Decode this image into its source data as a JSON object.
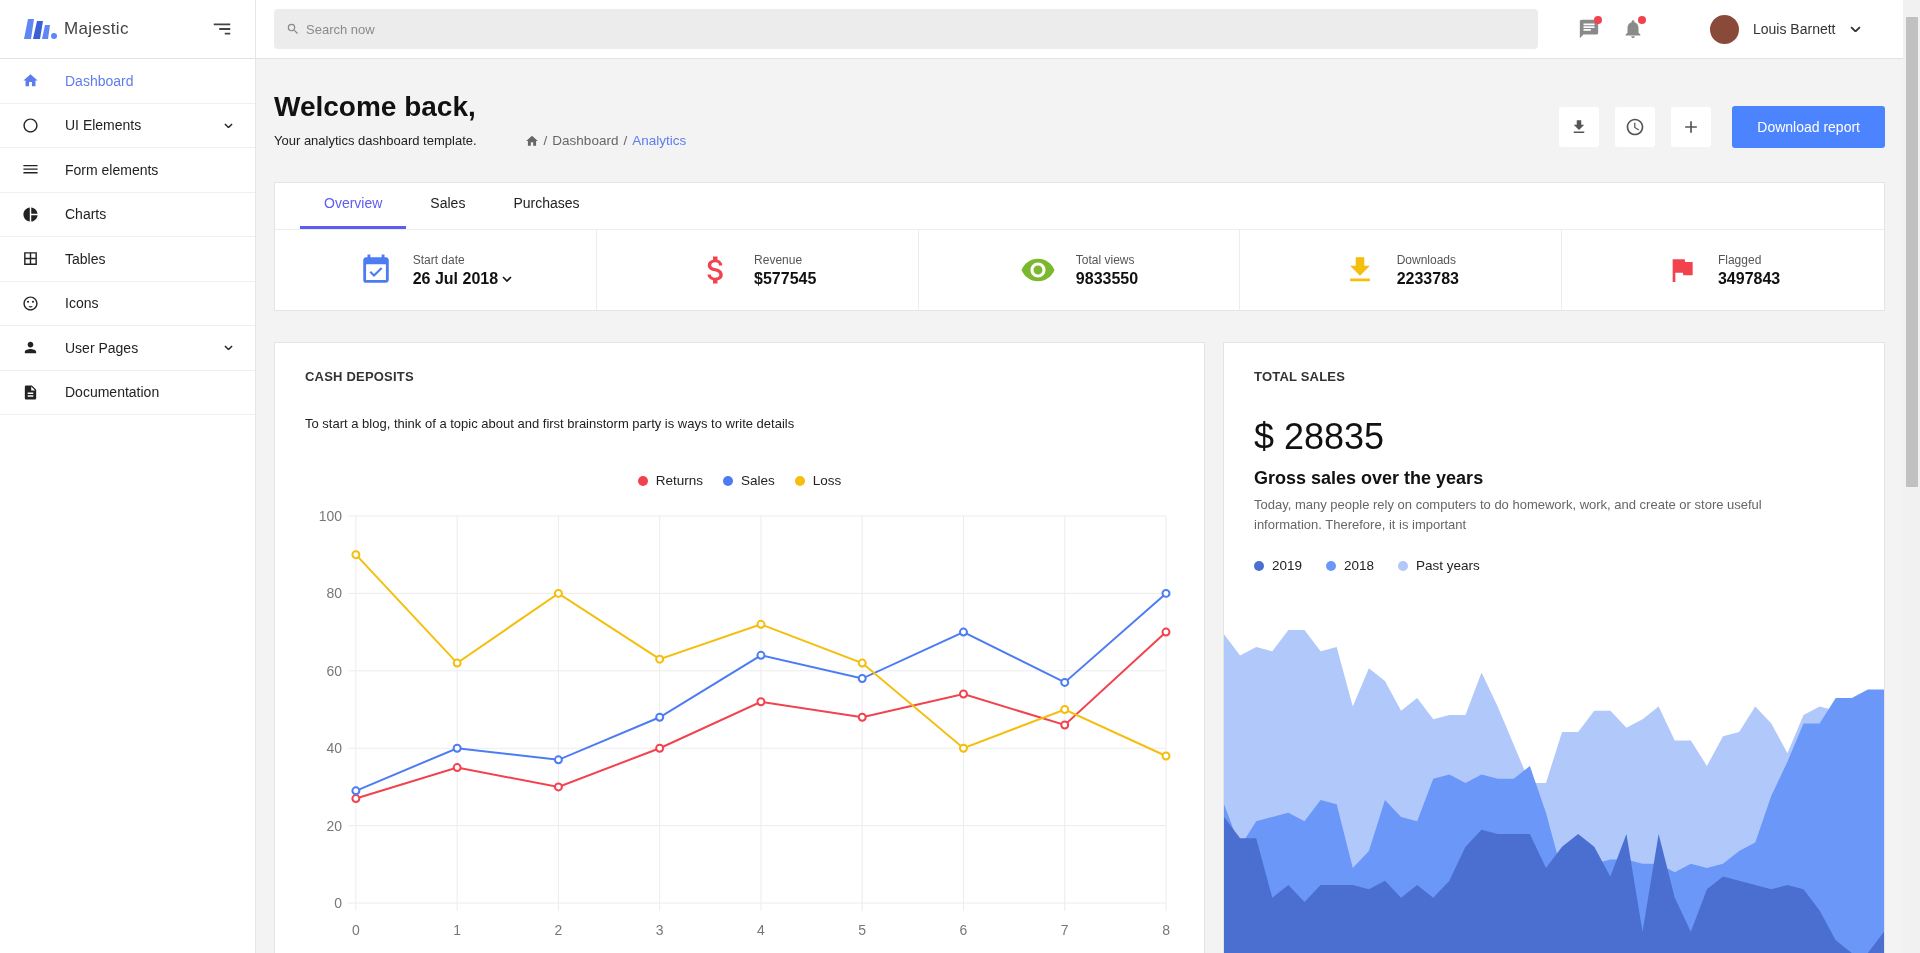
{
  "brand": {
    "name": "Majestic"
  },
  "sidebar": {
    "items": [
      {
        "kind": "home",
        "label": "Dashboard",
        "selected": true,
        "expandable": false
      },
      {
        "kind": "circle",
        "label": "UI Elements",
        "selected": false,
        "expandable": true
      },
      {
        "kind": "lines",
        "label": "Form elements",
        "selected": false,
        "expandable": false
      },
      {
        "kind": "pie",
        "label": "Charts",
        "selected": false,
        "expandable": false
      },
      {
        "kind": "table",
        "label": "Tables",
        "selected": false,
        "expandable": false
      },
      {
        "kind": "smile",
        "label": "Icons",
        "selected": false,
        "expandable": false
      },
      {
        "kind": "person",
        "label": "User Pages",
        "selected": false,
        "expandable": true
      },
      {
        "kind": "doc",
        "label": "Documentation",
        "selected": false,
        "expandable": false
      }
    ]
  },
  "topbar": {
    "search": {
      "placeholder": "Search now"
    },
    "notifications": [
      {
        "kind": "chat",
        "unread": true
      },
      {
        "kind": "bell",
        "unread": true
      }
    ],
    "user": {
      "name": "Louis Barnett"
    }
  },
  "header": {
    "title": "Welcome back,",
    "subtitle": "Your analytics dashboard template.",
    "breadcrumb": {
      "separator": "/",
      "items": [
        {
          "label": "Dashboard",
          "selected": false
        },
        {
          "label": "Analytics",
          "selected": true
        }
      ]
    },
    "actions": [
      {
        "kind": "download"
      },
      {
        "kind": "clock"
      },
      {
        "kind": "plus"
      }
    ],
    "primary_button": "Download report"
  },
  "tabs": [
    {
      "label": "Overview",
      "selected": true
    },
    {
      "label": "Sales",
      "selected": false
    },
    {
      "label": "Purchases",
      "selected": false
    }
  ],
  "stats": [
    {
      "kind": "calendar",
      "label": "Start date",
      "value": "26 Jul 2018",
      "dropdown": true
    },
    {
      "kind": "dollar",
      "label": "Revenue",
      "value": "$577545",
      "dropdown": false
    },
    {
      "kind": "eye",
      "label": "Total views",
      "value": "9833550",
      "dropdown": false
    },
    {
      "kind": "download",
      "label": "Downloads",
      "value": "2233783",
      "dropdown": false
    },
    {
      "kind": "flag",
      "label": "Flagged",
      "value": "3497843",
      "dropdown": false
    }
  ],
  "cash_deposits": {
    "title": "CASH DEPOSITS",
    "description": "To start a blog, think of a topic about and first brainstorm party is ways to write details",
    "chart_data": {
      "type": "line",
      "x": [
        0,
        1,
        2,
        3,
        4,
        5,
        6,
        7,
        8
      ],
      "xlim": [
        0,
        8
      ],
      "ylim": [
        0,
        100
      ],
      "grid": true,
      "yticks": [
        0,
        20,
        40,
        60,
        80,
        100
      ],
      "xticks": [
        0,
        1,
        2,
        3,
        4,
        5,
        6,
        7,
        8
      ],
      "series": [
        {
          "name": "Returns",
          "color": "#f2424e",
          "marker": "circle",
          "values": [
            27,
            35,
            30,
            40,
            52,
            48,
            54,
            46,
            70
          ]
        },
        {
          "name": "Sales",
          "color": "#4c7cf3",
          "marker": "circle",
          "values": [
            29,
            40,
            37,
            48,
            64,
            58,
            70,
            57,
            80
          ]
        },
        {
          "name": "Loss",
          "color": "#f5bd0c",
          "marker": "circle",
          "values": [
            90,
            62,
            80,
            63,
            72,
            62,
            40,
            50,
            38
          ]
        }
      ]
    }
  },
  "total_sales": {
    "title": "TOTAL SALES",
    "amount": "$ 28835",
    "subtitle": "Gross sales over the years",
    "description": "Today, many people rely on computers to do homework, work, and create or store useful information. Therefore, it is important",
    "legend": [
      {
        "label": "2019",
        "color": "#4a6fd1"
      },
      {
        "label": "2018",
        "color": "#6b97f8"
      },
      {
        "label": "Past years",
        "color": "#b1c8fb"
      }
    ]
  }
}
